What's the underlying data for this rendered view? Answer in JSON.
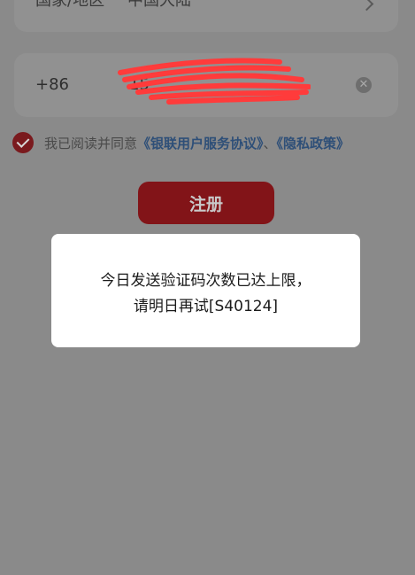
{
  "form": {
    "region_label": "国家/地区",
    "region_value": "中国大陆",
    "country_code": "+86",
    "phone_number_visible": "15",
    "agree_prefix": "我已阅读并同意",
    "user_agreement_link": "《银联用户服务协议》",
    "separator": "、",
    "privacy_link": "《隐私政策》",
    "register_label": "注册"
  },
  "dialog": {
    "line1": "今日发送验证码次数已达上限，",
    "line2": "请明日再试[S40124]"
  },
  "colors": {
    "overlay_bg": "#8a8a8a",
    "accent": "#821418",
    "link": "#2e4f78",
    "redaction": "#ff3b3b",
    "dialog_bg": "#ffffff"
  },
  "icons": [
    "chevron-right-icon",
    "clear-icon",
    "check-icon"
  ]
}
